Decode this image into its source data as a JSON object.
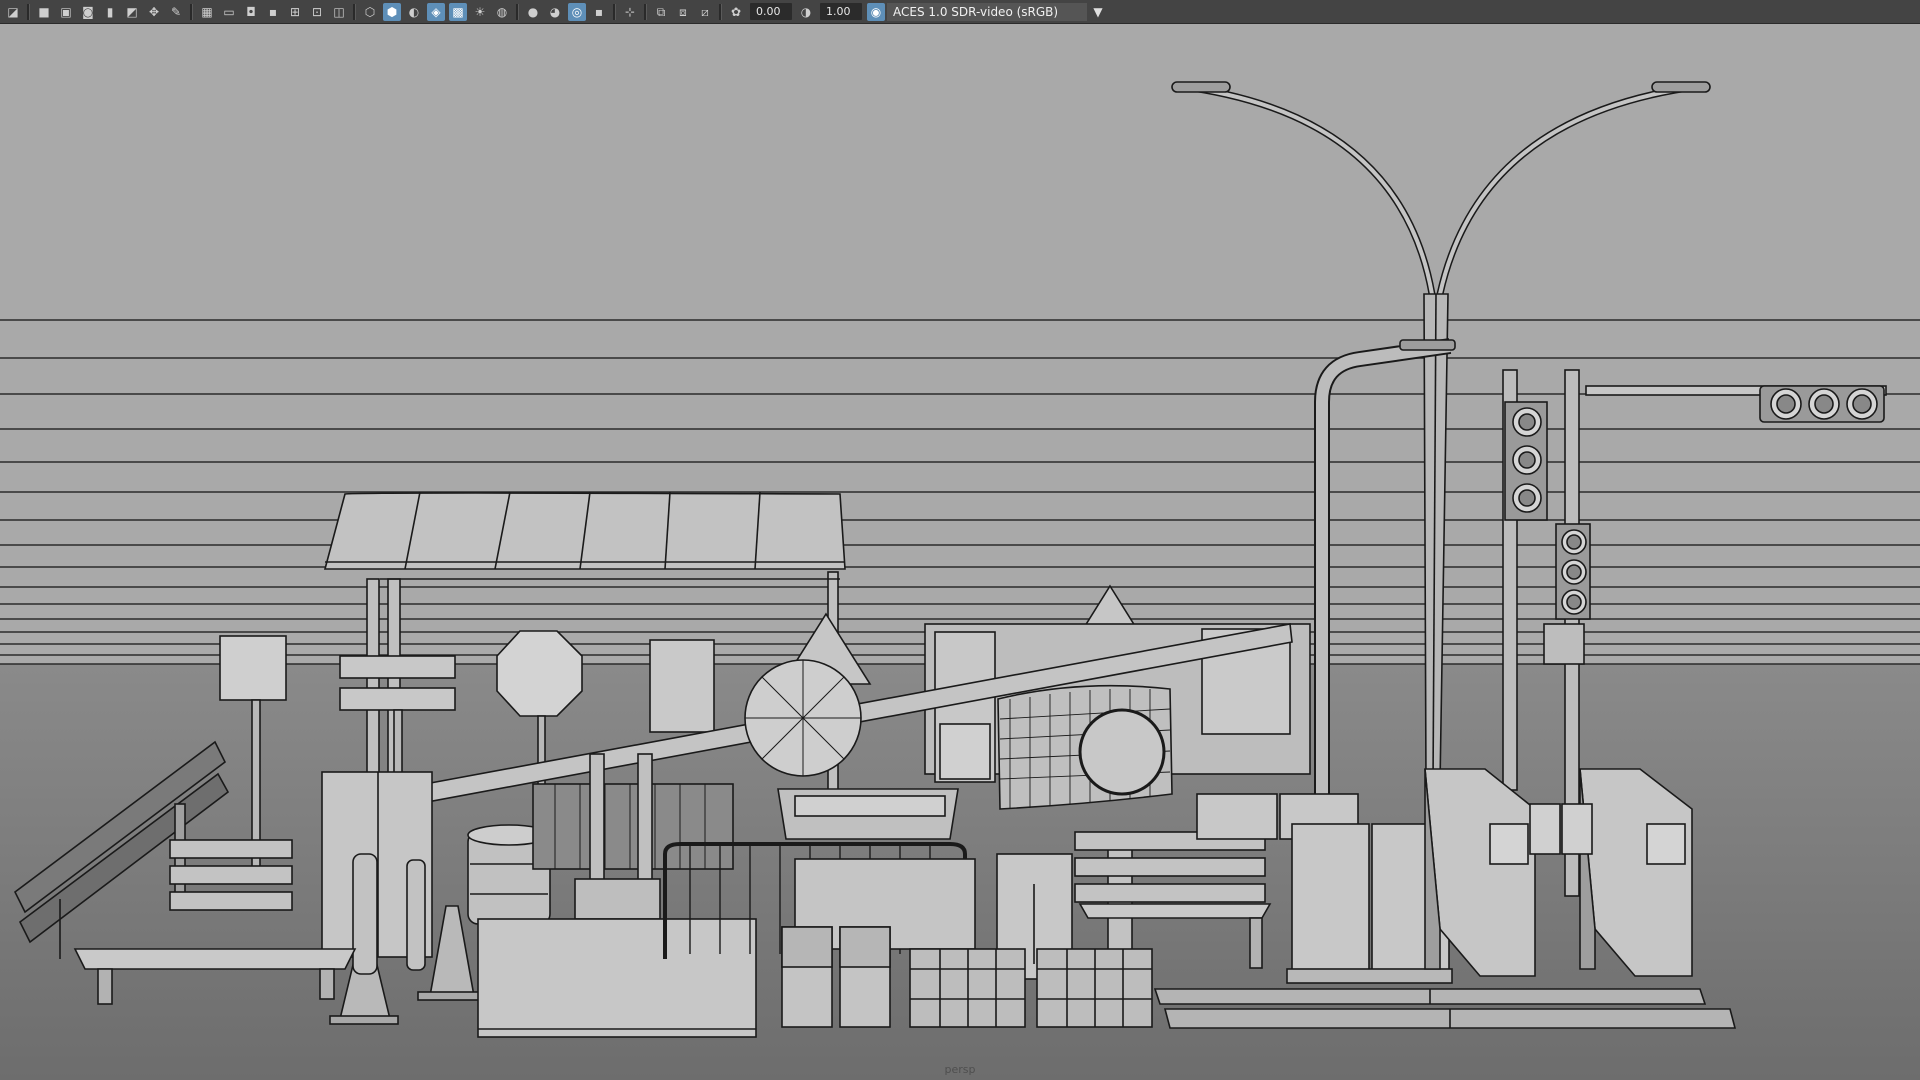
{
  "toolbar": {
    "icons": [
      "menu-icon",
      "camera-icon",
      "camera-attr-icon",
      "bookmark-icon",
      "image-plane-icon",
      "grid-icon",
      "film-gate-icon",
      "resolution-gate-icon",
      "safe-action-icon",
      "wireframe-icon",
      "smooth-shade-icon",
      "xray-icon",
      "lights-icon",
      "shadows-icon",
      "isolate-icon",
      "gamma-icon"
    ],
    "exposure_value": "0.00",
    "gamma_value": "1.00",
    "colorspace_label": "ACES 1.0 SDR-video (sRGB)",
    "dropdown_icon": "chevron-down-icon"
  },
  "viewport": {
    "camera_label": "persp",
    "background_color": "#7b7b7b",
    "wire_color": "#1a1a1a",
    "surface_color": "#b4b4b4"
  }
}
